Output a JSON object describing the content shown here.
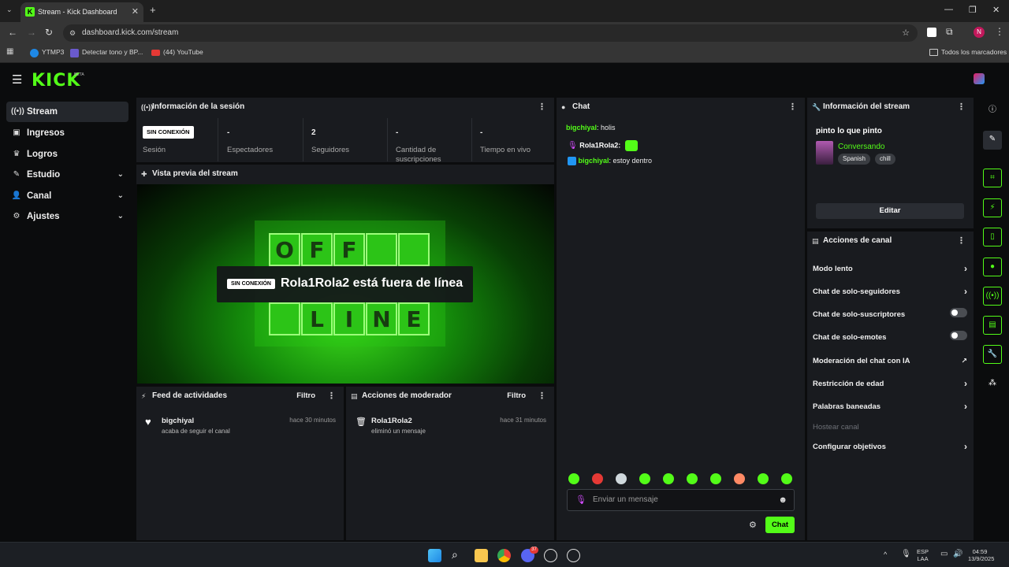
{
  "browser": {
    "tab_title": "Stream - Kick Dashboard",
    "url": "dashboard.kick.com/stream",
    "bookmarks": [
      "YTMP3",
      "Detectar tono y BP...",
      "(44) YouTube"
    ],
    "bookmarks_folder": "Todos los marcadores",
    "profile_initial": "N"
  },
  "header": {
    "logo": "KICK",
    "beta": "BETA"
  },
  "sidebar": {
    "items": [
      {
        "label": "Stream",
        "icon": "broadcast-icon"
      },
      {
        "label": "Ingresos",
        "icon": "money-icon"
      },
      {
        "label": "Logros",
        "icon": "trophy-icon"
      },
      {
        "label": "Estudio",
        "icon": "studio-icon"
      },
      {
        "label": "Canal",
        "icon": "channel-icon"
      },
      {
        "label": "Ajustes",
        "icon": "gear-icon"
      }
    ]
  },
  "session": {
    "title": "Información de la sesión",
    "status_badge": "SIN CONEXIÓN",
    "status_label": "Sesión",
    "stats": [
      {
        "value": "-",
        "label": "Espectadores"
      },
      {
        "value": "2",
        "label": "Seguidores"
      },
      {
        "value": "-",
        "label": "Cantidad de suscripciones"
      },
      {
        "value": "-",
        "label": "Tiempo en vivo"
      }
    ]
  },
  "preview": {
    "title": "Vista previa del stream",
    "badge": "SIN CONEXIÓN",
    "offline_text": "Rola1Rola2 está fuera de línea",
    "letters_top": [
      "O",
      "F",
      "F",
      ""
    ],
    "letters_bottom": [
      "",
      "L",
      "I",
      "N",
      "E"
    ]
  },
  "activity": {
    "title": "Feed de actividades",
    "filter": "Filtro",
    "item_user": "bigchiyal",
    "item_text": "acaba de seguir el canal",
    "item_time": "hace 30 minutos"
  },
  "moderator": {
    "title": "Acciones de moderador",
    "filter": "Filtro",
    "item_user": "Rola1Rola2",
    "item_text": "eliminó un mensaje",
    "item_time": "hace 31 minutos"
  },
  "chat": {
    "title": "Chat",
    "messages": [
      {
        "user": "bigchiyal",
        "text": ": holis"
      },
      {
        "user": "Rola1Rola2",
        "text": ":"
      },
      {
        "user": "bigchiyal",
        "text": ": estoy dentro"
      }
    ],
    "placeholder": "Enviar un mensaje",
    "send_label": "Chat"
  },
  "stream_info": {
    "title": "Información del stream",
    "stream_title": "pinto lo que pinto",
    "category": "Conversando",
    "tags": [
      "Spanish",
      "chill"
    ],
    "edit_label": "Editar"
  },
  "channel_actions": {
    "title": "Acciones de canal",
    "items": [
      {
        "label": "Modo lento",
        "control": "arrow"
      },
      {
        "label": "Chat de solo-seguidores",
        "control": "arrow"
      },
      {
        "label": "Chat de solo-suscriptores",
        "control": "toggle"
      },
      {
        "label": "Chat de solo-emotes",
        "control": "toggle"
      },
      {
        "label": "Moderación del chat con IA",
        "control": "external"
      },
      {
        "label": "Restricción de edad",
        "control": "arrow"
      },
      {
        "label": "Palabras baneadas",
        "control": "arrow"
      },
      {
        "label": "Hostear canal",
        "control": "none"
      },
      {
        "label": "Configurar objetivos",
        "control": "arrow"
      }
    ]
  },
  "taskbar": {
    "lang_top": "ESP",
    "lang_bottom": "LAA",
    "time": "04:59",
    "date": "13/9/2025",
    "discord_badge": "37"
  },
  "colors": {
    "accent": "#53fc18",
    "panel": "#191b1f",
    "background": "#0b0c0d"
  }
}
